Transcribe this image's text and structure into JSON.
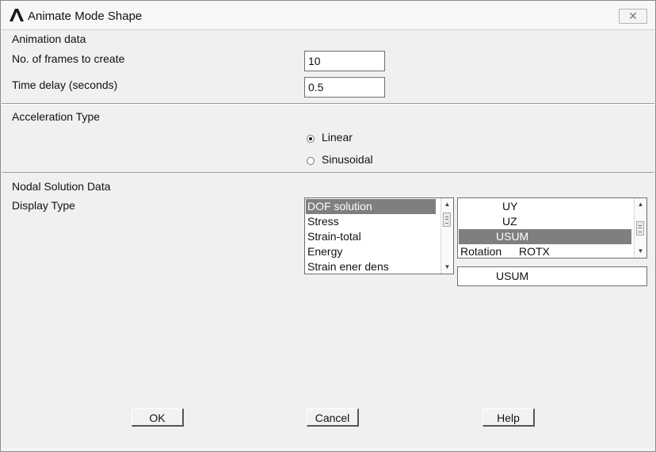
{
  "window": {
    "title": "Animate Mode Shape",
    "close_label": "✕"
  },
  "animation": {
    "section_label": "Animation data",
    "frames_label": "No. of frames to create",
    "frames_value": "10",
    "delay_label": "Time delay (seconds)",
    "delay_value": "0.5"
  },
  "acceleration": {
    "section_label": "Acceleration Type",
    "options": [
      {
        "label": "Linear",
        "checked": true
      },
      {
        "label": "Sinusoidal",
        "checked": false
      }
    ]
  },
  "nodal": {
    "section_label": "Nodal Solution Data",
    "display_type_label": "Display Type",
    "left_list": [
      "DOF solution",
      "Stress",
      "Strain-total",
      "Energy",
      "Strain ener dens"
    ],
    "left_selected": 0,
    "right_list": [
      {
        "prefix": "",
        "item": "UY"
      },
      {
        "prefix": "",
        "item": "UZ"
      },
      {
        "prefix": "",
        "item": "USUM"
      },
      {
        "prefix": "Rotation",
        "item": "ROTX"
      }
    ],
    "right_selected": 2,
    "selection_value": "USUM"
  },
  "buttons": {
    "ok": "OK",
    "cancel": "Cancel",
    "help": "Help"
  },
  "icons": {
    "app": "ansys-logo-icon",
    "close": "close-icon",
    "scroll_up": "scroll-up-arrow-icon",
    "scroll_down": "scroll-down-arrow-icon"
  }
}
